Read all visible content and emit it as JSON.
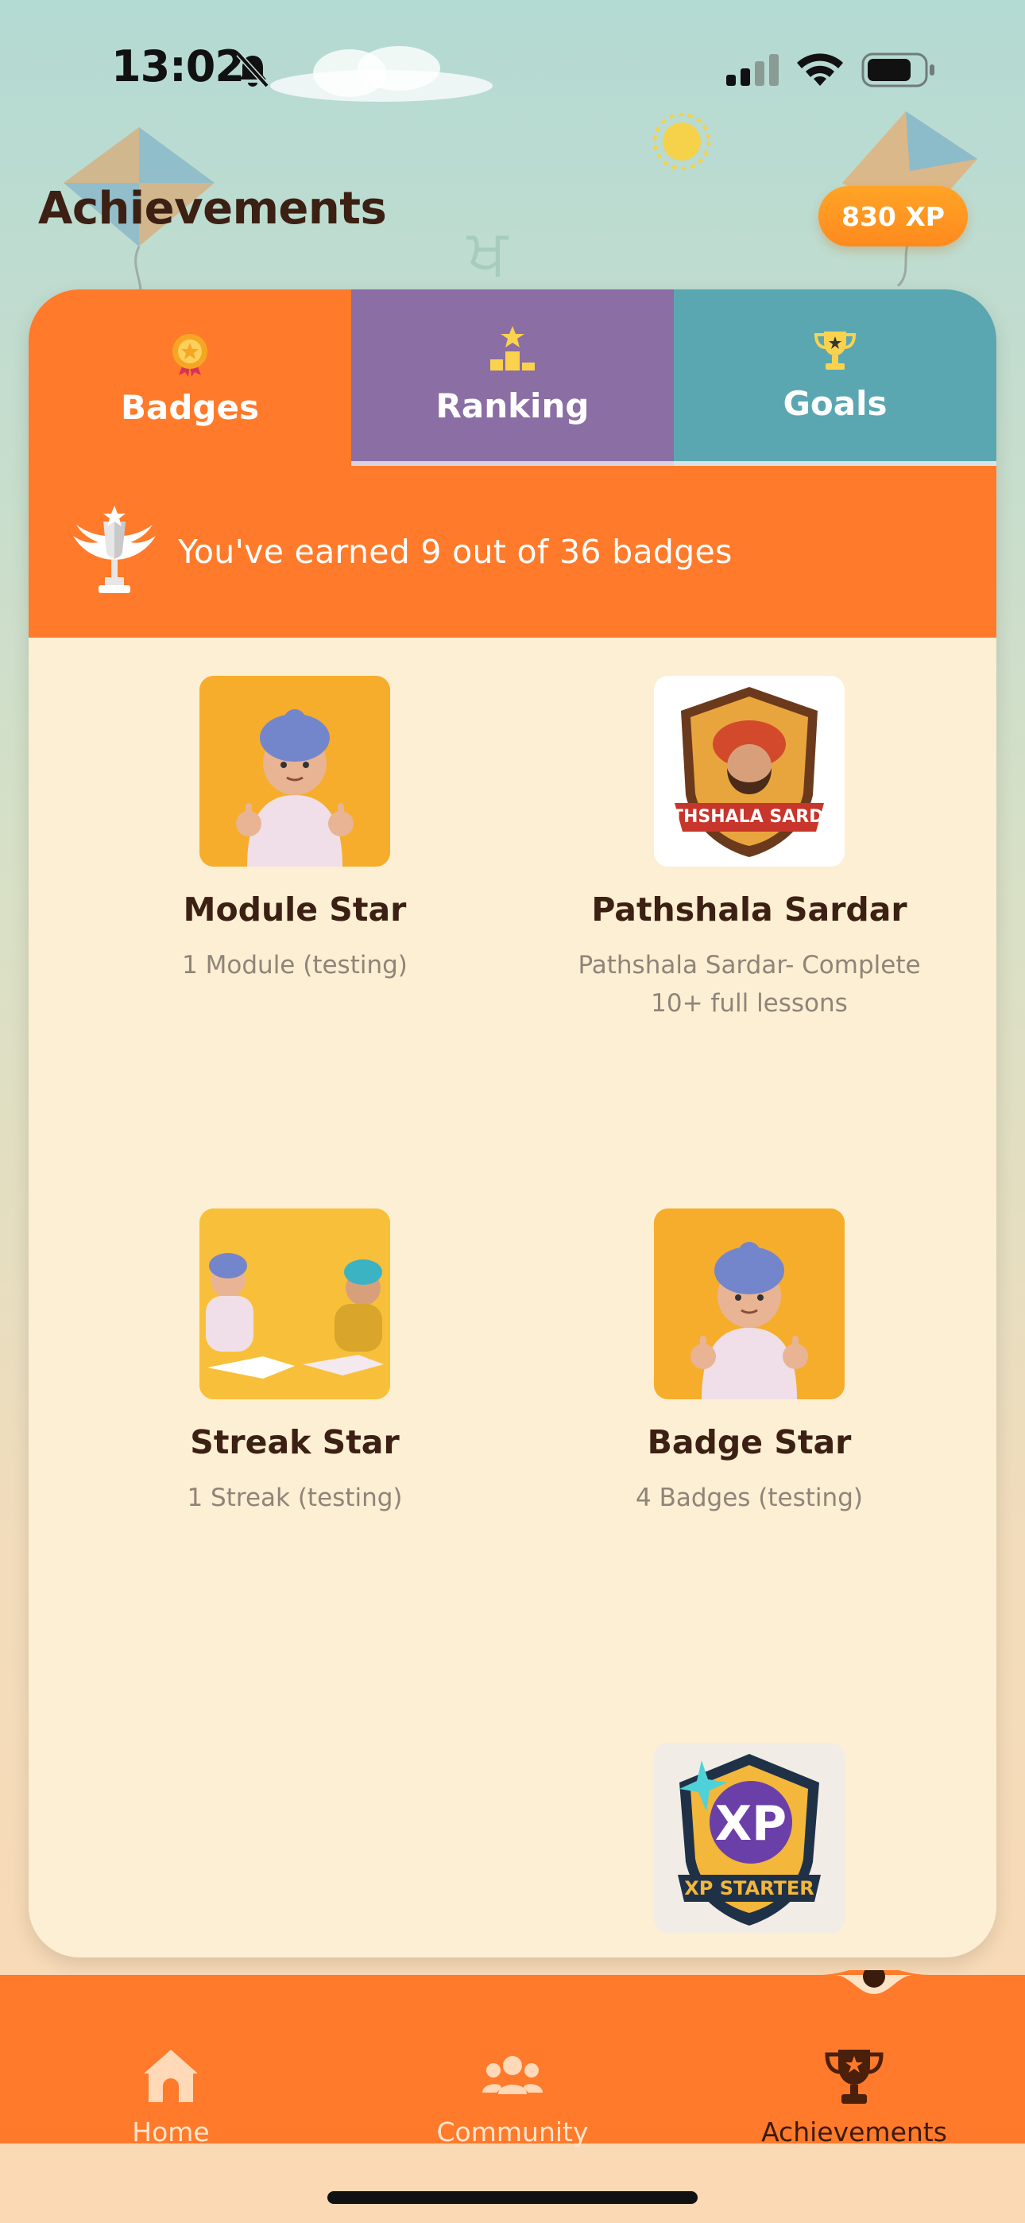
{
  "status_bar": {
    "time": "13:02"
  },
  "background": {
    "gurmukhi_char": "ਖ"
  },
  "header": {
    "title": "Achievements",
    "xp": "830 XP"
  },
  "tabs": [
    {
      "label": "Badges",
      "icon": "medal-icon",
      "color": "#ff7a2a",
      "active": true
    },
    {
      "label": "Ranking",
      "icon": "podium-icon",
      "color": "#8a6ea4",
      "active": false
    },
    {
      "label": "Goals",
      "icon": "trophy-icon",
      "color": "#5aa7b2",
      "active": false
    }
  ],
  "banner": {
    "text": "You've earned 9 out of 36 badges"
  },
  "badges": [
    {
      "name": "Module Star",
      "desc": "1 Module (testing)",
      "image": "boy-thumbs-up"
    },
    {
      "name": "Pathshala Sardar",
      "desc": "Pathshala Sardar-  Complete 10+ full lessons",
      "image": "pathshala-sardar-shield",
      "image_text": "PATHSHALA SARDAR"
    },
    {
      "name": "Streak Star",
      "desc": "1 Streak (testing)",
      "image": "two-boys-reading"
    },
    {
      "name": "Badge Star",
      "desc": "4 Badges (testing)",
      "image": "boy-thumbs-up"
    },
    {
      "name": "",
      "desc": "",
      "image": "xp-starter-shield",
      "image_text_big": "XP",
      "image_text": "XP STARTER"
    }
  ],
  "nav": {
    "items": [
      {
        "label": "Home",
        "icon": "home-icon",
        "active": false
      },
      {
        "label": "Community",
        "icon": "community-icon",
        "active": false
      },
      {
        "label": "Achievements",
        "icon": "trophy-icon",
        "active": true
      }
    ]
  },
  "colors": {
    "accent": "#ff7a2a",
    "card_bg": "#fdefd3",
    "title": "#3b2013"
  }
}
